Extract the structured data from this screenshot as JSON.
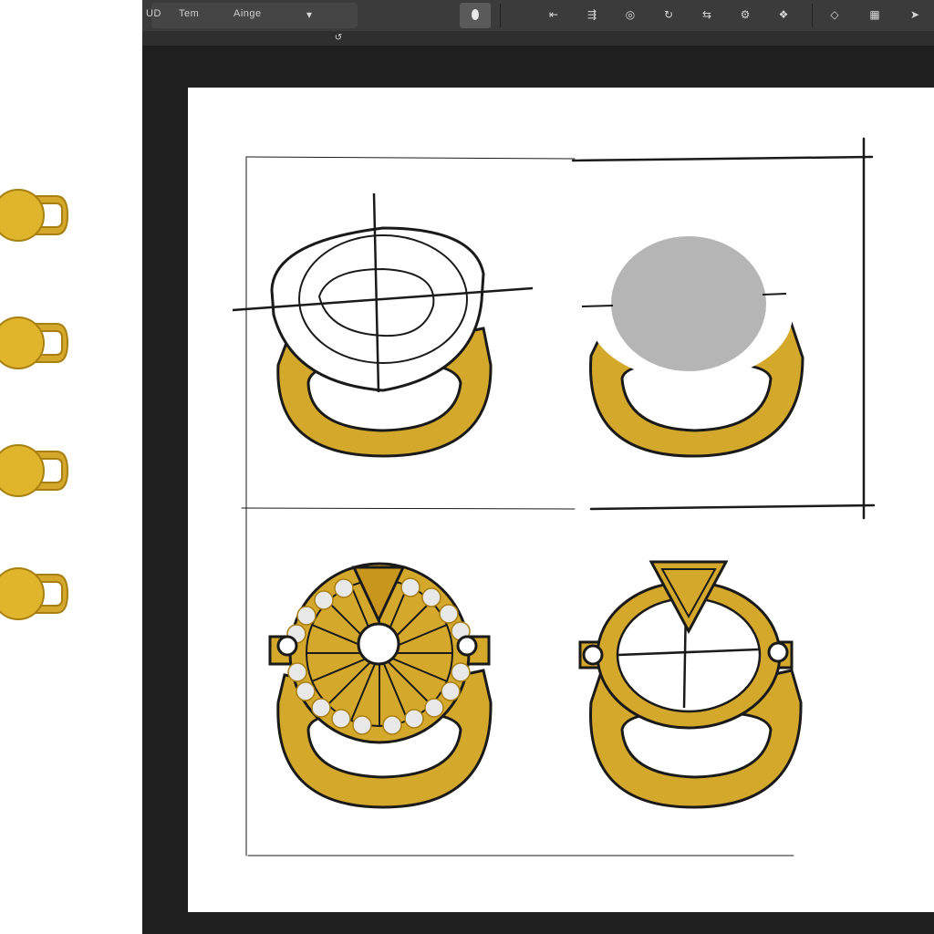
{
  "toolbar": {
    "left_label": "UD",
    "tab_label": "Tem",
    "field_label": "Ainge",
    "dropdown_icon": "caret-down-icon",
    "active_tool_icon": "ellipse-tool-icon",
    "subbar_icon": "undo-icon",
    "colors": {
      "bar": "#3b3b3b",
      "workspace": "#1f1f1f"
    }
  },
  "canvas": {
    "colors": {
      "gold": "#d4a82a",
      "gold_dark": "#a97f10",
      "outline": "#1a1a1a",
      "stone_gray": "#b5b5b5",
      "diamond": "#e8e8e8"
    }
  }
}
